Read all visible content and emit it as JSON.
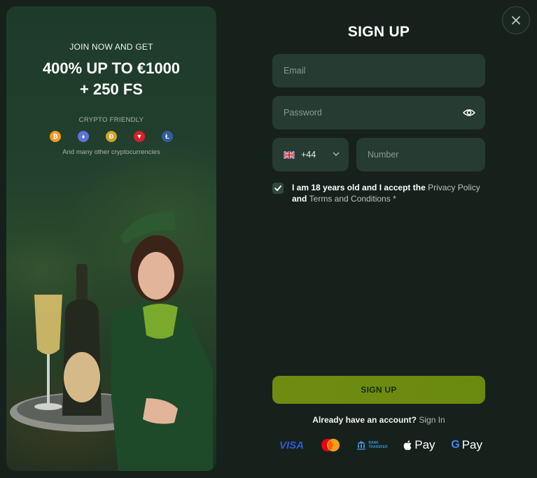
{
  "promo": {
    "join_text": "JOIN NOW AND GET",
    "headline_line1": "400% UP TO €1000",
    "headline_line2": "+ 250 FS",
    "crypto_label": "CRYPTO FRIENDLY",
    "crypto_icons": [
      "bitcoin-icon",
      "ethereum-icon",
      "dogecoin-icon",
      "tron-icon",
      "litecoin-icon"
    ],
    "others_text": "And many other cryptocurrencies"
  },
  "form": {
    "title": "SIGN UP",
    "email_placeholder": "Email",
    "password_placeholder": "Password",
    "phone_code": "+44",
    "number_placeholder": "Number",
    "agree_prefix": "I am 18 years old and I accept the ",
    "privacy_link": "Privacy Policy",
    "agree_and": "and ",
    "terms_link": "Terms and Conditions",
    "required_mark": " *",
    "submit_label": "SIGN UP",
    "already_text": "Already have an account?",
    "signin_link": "Sign In"
  },
  "payments": {
    "visa": "VISA",
    "bank_line1": "BANK",
    "bank_line2": "TRANSFER",
    "apple_pay": "Pay",
    "google_pay": "Pay"
  },
  "colors": {
    "accent": "#6f8c12",
    "field_bg": "#263c32",
    "page_bg": "#16211c"
  }
}
